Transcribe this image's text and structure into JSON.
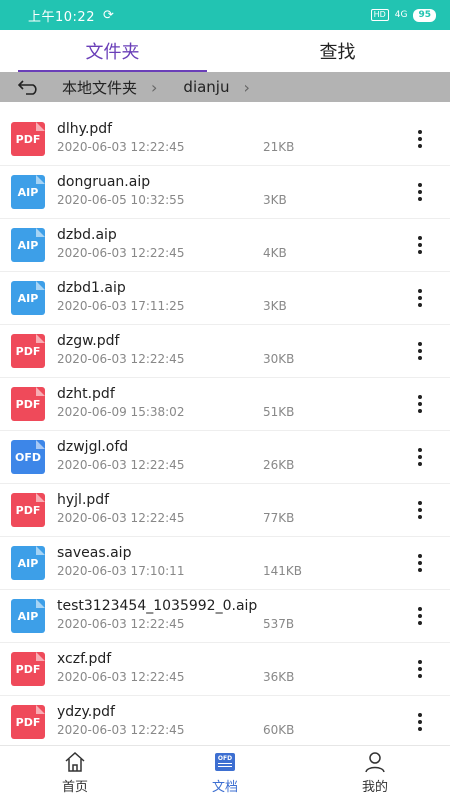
{
  "status_bar": {
    "time": "上午10:22",
    "sync_icon": "⟳",
    "hd": "HD",
    "signal": "4G",
    "battery": "95"
  },
  "tabs": [
    {
      "label": "文件夹",
      "active": true
    },
    {
      "label": "查找",
      "active": false
    }
  ],
  "breadcrumb": {
    "crumbs": [
      "本地文件夹",
      "dianju"
    ]
  },
  "files": [
    {
      "type": "pdf",
      "icon_label": "PDF",
      "name": "dlhy.pdf",
      "date": "2020-06-03 12:22:45",
      "size": "21KB"
    },
    {
      "type": "aip",
      "icon_label": "AIP",
      "name": "dongruan.aip",
      "date": "2020-06-05 10:32:55",
      "size": "3KB"
    },
    {
      "type": "aip",
      "icon_label": "AIP",
      "name": "dzbd.aip",
      "date": "2020-06-03 12:22:45",
      "size": "4KB"
    },
    {
      "type": "aip",
      "icon_label": "AIP",
      "name": "dzbd1.aip",
      "date": "2020-06-03 17:11:25",
      "size": "3KB"
    },
    {
      "type": "pdf",
      "icon_label": "PDF",
      "name": "dzgw.pdf",
      "date": "2020-06-03 12:22:45",
      "size": "30KB"
    },
    {
      "type": "pdf",
      "icon_label": "PDF",
      "name": "dzht.pdf",
      "date": "2020-06-09 15:38:02",
      "size": "51KB"
    },
    {
      "type": "ofd",
      "icon_label": "OFD",
      "name": "dzwjgl.ofd",
      "date": "2020-06-03 12:22:45",
      "size": "26KB"
    },
    {
      "type": "pdf",
      "icon_label": "PDF",
      "name": "hyjl.pdf",
      "date": "2020-06-03 12:22:45",
      "size": "77KB"
    },
    {
      "type": "aip",
      "icon_label": "AIP",
      "name": "saveas.aip",
      "date": "2020-06-03 17:10:11",
      "size": "141KB"
    },
    {
      "type": "aip",
      "icon_label": "AIP",
      "name": "test3123454_1035992_0.aip",
      "date": "2020-06-03 12:22:45",
      "size": "537B"
    },
    {
      "type": "pdf",
      "icon_label": "PDF",
      "name": "xczf.pdf",
      "date": "2020-06-03 12:22:45",
      "size": "36KB"
    },
    {
      "type": "pdf",
      "icon_label": "PDF",
      "name": "ydzy.pdf",
      "date": "2020-06-03 12:22:45",
      "size": "60KB"
    }
  ],
  "bottom_nav": [
    {
      "label": "首页",
      "icon": "home-icon",
      "active": false
    },
    {
      "label": "文档",
      "icon": "ofd-document-icon",
      "icon_label": "OFD",
      "active": true
    },
    {
      "label": "我的",
      "icon": "user-icon",
      "active": false
    }
  ],
  "colors": {
    "status_bar": "#22c4b2",
    "tab_active": "#6a3fb8",
    "nav_active": "#3d6fd1",
    "pdf": "#ef4a5a",
    "aip": "#3d9fe8",
    "ofd": "#3d86e8"
  }
}
